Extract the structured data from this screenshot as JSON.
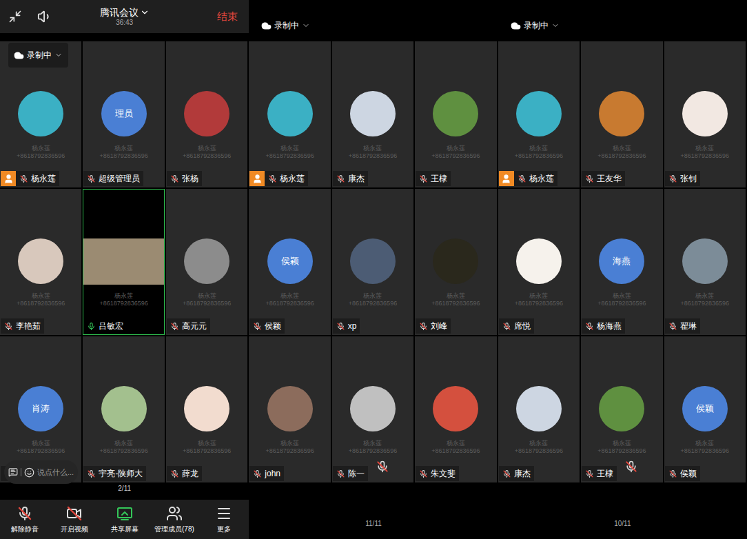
{
  "watermark": {
    "name": "杨永莲",
    "phone": "+8618792836596"
  },
  "screens": [
    {
      "header": {
        "kind": "full",
        "title": "腾讯会议",
        "time": "36:43",
        "end": "结束",
        "recording": "录制中"
      },
      "tiles": [
        {
          "name": "杨永莲",
          "host": true,
          "muted": true,
          "active": false,
          "center_mic": false,
          "avatar": {
            "kind": "image",
            "color": "#3bb0c4"
          }
        },
        {
          "name": "超级管理员",
          "host": false,
          "muted": true,
          "active": false,
          "center_mic": false,
          "avatar": {
            "kind": "text",
            "text": "理员"
          }
        },
        {
          "name": "张杨",
          "host": false,
          "muted": true,
          "active": false,
          "center_mic": false,
          "avatar": {
            "kind": "image",
            "color": "#b23a3a"
          }
        },
        {
          "name": "李艳茹",
          "host": false,
          "muted": true,
          "active": false,
          "center_mic": false,
          "avatar": {
            "kind": "image",
            "color": "#d8c8bc"
          }
        },
        {
          "name": "吕敏宏",
          "host": false,
          "muted": false,
          "active": true,
          "center_mic": false,
          "avatar": {
            "kind": "video",
            "color": "#9b8b72"
          }
        },
        {
          "name": "高元元",
          "host": false,
          "muted": true,
          "active": false,
          "center_mic": false,
          "avatar": {
            "kind": "image",
            "color": "#8c8c8c"
          }
        },
        {
          "host": false,
          "muted": true,
          "active": false,
          "center_mic": false,
          "avatar": {
            "kind": "text",
            "text": "肖涛"
          }
        },
        {
          "name": "宇亮-陕师大",
          "host": false,
          "muted": true,
          "active": false,
          "center_mic": false,
          "avatar": {
            "kind": "image",
            "color": "#a3c08e"
          }
        },
        {
          "name": "薛龙",
          "host": false,
          "muted": true,
          "active": false,
          "center_mic": false,
          "avatar": {
            "kind": "image",
            "color": "#f2dccf"
          }
        }
      ],
      "chat": {
        "placeholder": "说点什么..."
      },
      "bottom": {
        "kind": "toolbar",
        "page": "2/11",
        "toolbar": [
          "解除静音",
          "开启视频",
          "共享屏幕",
          "管理成员(78)",
          "更多"
        ]
      }
    },
    {
      "header": {
        "kind": "compact",
        "recording": "录制中"
      },
      "tiles": [
        {
          "name": "杨永莲",
          "host": true,
          "muted": true,
          "active": false,
          "center_mic": false,
          "avatar": {
            "kind": "image",
            "color": "#3bb0c4"
          }
        },
        {
          "name": "康杰",
          "host": false,
          "muted": true,
          "active": false,
          "center_mic": false,
          "avatar": {
            "kind": "image",
            "color": "#cdd6e2"
          }
        },
        {
          "name": "王棣",
          "host": false,
          "muted": true,
          "active": false,
          "center_mic": false,
          "avatar": {
            "kind": "image",
            "color": "#5f9040"
          }
        },
        {
          "name": "侯颖",
          "host": false,
          "muted": true,
          "active": false,
          "center_mic": false,
          "avatar": {
            "kind": "text",
            "text": "侯颖"
          }
        },
        {
          "name": "xp",
          "host": false,
          "muted": true,
          "active": false,
          "center_mic": false,
          "avatar": {
            "kind": "image",
            "color": "#4c5c74"
          }
        },
        {
          "name": "刘峰",
          "host": false,
          "muted": true,
          "active": false,
          "center_mic": false,
          "avatar": {
            "kind": "image",
            "color": "#2a281c"
          }
        },
        {
          "name": "john",
          "host": false,
          "muted": true,
          "active": false,
          "center_mic": false,
          "avatar": {
            "kind": "image",
            "color": "#8c6c5c"
          }
        },
        {
          "name": "陈一",
          "host": false,
          "muted": true,
          "active": false,
          "center_mic": true,
          "avatar": {
            "kind": "image",
            "color": "#c0c0c0"
          }
        },
        {
          "name": "朱文斐",
          "host": false,
          "muted": true,
          "active": false,
          "center_mic": false,
          "avatar": {
            "kind": "image",
            "color": "#d4503e"
          }
        }
      ],
      "bottom": {
        "kind": "plain",
        "page": "11/11"
      }
    },
    {
      "header": {
        "kind": "compact",
        "recording": "录制中"
      },
      "tiles": [
        {
          "name": "杨永莲",
          "host": true,
          "muted": true,
          "active": false,
          "center_mic": false,
          "avatar": {
            "kind": "image",
            "color": "#3bb0c4"
          }
        },
        {
          "name": "王友华",
          "host": false,
          "muted": true,
          "active": false,
          "center_mic": false,
          "avatar": {
            "kind": "image",
            "color": "#c87a30"
          }
        },
        {
          "name": "张钊",
          "host": false,
          "muted": true,
          "active": false,
          "center_mic": false,
          "avatar": {
            "kind": "image",
            "color": "#f2e8e2"
          }
        },
        {
          "name": "席悦",
          "host": false,
          "muted": true,
          "active": false,
          "center_mic": false,
          "avatar": {
            "kind": "image",
            "color": "#f6f2ec"
          }
        },
        {
          "name": "杨海燕",
          "host": false,
          "muted": true,
          "active": false,
          "center_mic": false,
          "avatar": {
            "kind": "text",
            "text": "海燕"
          }
        },
        {
          "name": "翟琳",
          "host": false,
          "muted": true,
          "active": false,
          "center_mic": false,
          "avatar": {
            "kind": "image",
            "color": "#7c8c98"
          }
        },
        {
          "name": "康杰",
          "host": false,
          "muted": true,
          "active": false,
          "center_mic": false,
          "avatar": {
            "kind": "image",
            "color": "#cdd6e2"
          }
        },
        {
          "name": "王棣",
          "host": false,
          "muted": true,
          "active": false,
          "center_mic": true,
          "avatar": {
            "kind": "image",
            "color": "#5f9040"
          }
        },
        {
          "name": "侯颖",
          "host": false,
          "muted": true,
          "active": false,
          "center_mic": false,
          "avatar": {
            "kind": "text",
            "text": "侯颖"
          }
        }
      ],
      "bottom": {
        "kind": "plain",
        "page": "10/11"
      }
    }
  ]
}
